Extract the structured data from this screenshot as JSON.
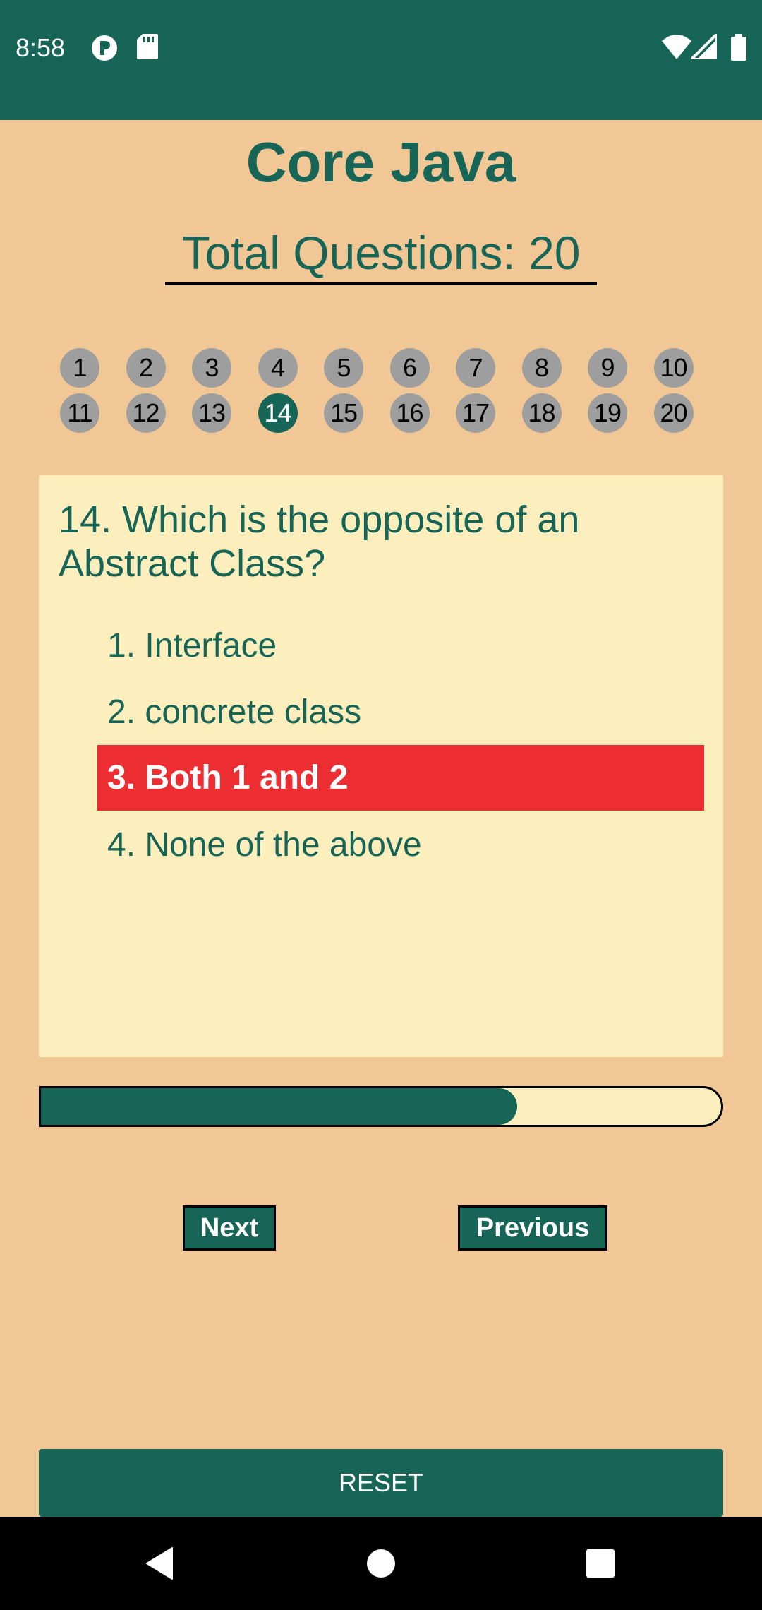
{
  "status_bar": {
    "time": "8:58",
    "background_color": "#176557",
    "left_icons": [
      "notification-app-icon",
      "sd-card-icon"
    ],
    "right_icons": [
      "wifi-icon",
      "cellular-signal-icon",
      "battery-icon"
    ]
  },
  "header": {
    "title": "Core Java",
    "total_questions_label": "Total Questions: 20"
  },
  "question_numbers": {
    "items": [
      "1",
      "2",
      "3",
      "4",
      "5",
      "6",
      "7",
      "8",
      "9",
      "10",
      "11",
      "12",
      "13",
      "14",
      "15",
      "16",
      "17",
      "18",
      "19",
      "20"
    ],
    "active": "14",
    "inactive_color": "#9e9e9e",
    "active_color": "#176557"
  },
  "question": {
    "text": "14. Which is the opposite of an Abstract Class?",
    "options": [
      {
        "label": "1. Interface",
        "selected": false
      },
      {
        "label": "2. concrete class",
        "selected": false
      },
      {
        "label": "3. Both 1 and 2",
        "selected": true
      },
      {
        "label": "4. None of the above",
        "selected": false
      }
    ],
    "selected_color": "#ec2d31"
  },
  "progress": {
    "fraction": 0.7
  },
  "nav": {
    "next_label": "Next",
    "previous_label": "Previous"
  },
  "reset": {
    "label": "RESET"
  },
  "system_nav": {
    "icons": [
      "back-icon",
      "home-icon",
      "recents-icon"
    ]
  },
  "colors": {
    "background": "#f1c795",
    "card": "#fdefbd",
    "accent": "#176557"
  }
}
